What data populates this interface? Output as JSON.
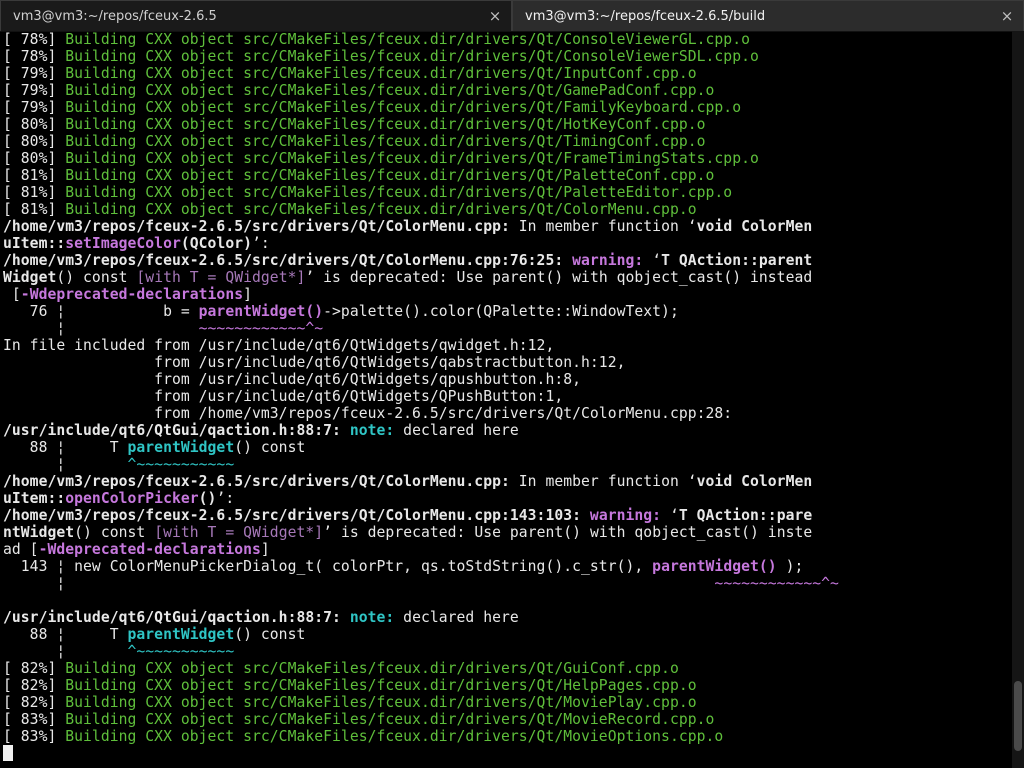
{
  "tabs": [
    {
      "label": "vm3@vm3:~/repos/fceux-2.6.5",
      "close": "×"
    },
    {
      "label": "vm3@vm3:~/repos/fceux-2.6.5/build",
      "close": "×"
    }
  ],
  "terminal": {
    "build1": [
      {
        "pct": "[ 78%] ",
        "msg": "Building CXX object src/CMakeFiles/fceux.dir/drivers/Qt/ConsoleViewerGL.cpp.o"
      },
      {
        "pct": "[ 78%] ",
        "msg": "Building CXX object src/CMakeFiles/fceux.dir/drivers/Qt/ConsoleViewerSDL.cpp.o"
      },
      {
        "pct": "[ 79%] ",
        "msg": "Building CXX object src/CMakeFiles/fceux.dir/drivers/Qt/InputConf.cpp.o"
      },
      {
        "pct": "[ 79%] ",
        "msg": "Building CXX object src/CMakeFiles/fceux.dir/drivers/Qt/GamePadConf.cpp.o"
      },
      {
        "pct": "[ 79%] ",
        "msg": "Building CXX object src/CMakeFiles/fceux.dir/drivers/Qt/FamilyKeyboard.cpp.o"
      },
      {
        "pct": "[ 80%] ",
        "msg": "Building CXX object src/CMakeFiles/fceux.dir/drivers/Qt/HotKeyConf.cpp.o"
      },
      {
        "pct": "[ 80%] ",
        "msg": "Building CXX object src/CMakeFiles/fceux.dir/drivers/Qt/TimingConf.cpp.o"
      },
      {
        "pct": "[ 80%] ",
        "msg": "Building CXX object src/CMakeFiles/fceux.dir/drivers/Qt/FrameTimingStats.cpp.o"
      },
      {
        "pct": "[ 81%] ",
        "msg": "Building CXX object src/CMakeFiles/fceux.dir/drivers/Qt/PaletteConf.cpp.o"
      },
      {
        "pct": "[ 81%] ",
        "msg": "Building CXX object src/CMakeFiles/fceux.dir/drivers/Qt/PaletteEditor.cpp.o"
      },
      {
        "pct": "[ 81%] ",
        "msg": "Building CXX object src/CMakeFiles/fceux.dir/drivers/Qt/ColorMenu.cpp.o"
      }
    ],
    "w1": {
      "l1": "/home/vm3/repos/fceux-2.6.5/src/drivers/Qt/ColorMenu.cpp:",
      "l1b": " In member function ‘",
      "l1c": "void ColorMen",
      "l2a": "uItem::",
      "l2b": "setImageColor",
      "l2c": "(QColor)",
      "l2d": "’:",
      "l3a": "/home/vm3/repos/fceux-2.6.5/src/drivers/Qt/ColorMenu.cpp:76:25: ",
      "l3b": "warning: ",
      "l3c": "‘",
      "l3d": "T QAction::parent",
      "l4a": "Widget",
      "l4b": "() const ",
      "l4c": "[with T = QWidget*]",
      "l4d": "’ is deprecated: Use parent() with qobject_cast() instead",
      "l5a": " [",
      "l5b": "-Wdeprecated-declarations",
      "l5c": "]",
      "l6a": "   76 ¦           b = ",
      "l6b": "parentWidget()",
      "l6c": "->palette().color(QPalette::WindowText);",
      "l7a": "      ¦               ",
      "l7b": "~~~~~~~~~~~~^~",
      "l8": "In file included from /usr/include/qt6/QtWidgets/qwidget.h:12,",
      "l9": "                 from /usr/include/qt6/QtWidgets/qabstractbutton.h:12,",
      "l10": "                 from /usr/include/qt6/QtWidgets/qpushbutton.h:8,",
      "l11": "                 from /usr/include/qt6/QtWidgets/QPushButton:1,",
      "l12": "                 from /home/vm3/repos/fceux-2.6.5/src/drivers/Qt/ColorMenu.cpp:28:",
      "l13a": "/usr/include/qt6/QtGui/qaction.h:88:7: ",
      "l13b": "note: ",
      "l13c": "declared here",
      "l14a": "   88 ¦     T ",
      "l14b": "parentWidget",
      "l14c": "() const",
      "l15a": "      ¦       ",
      "l15b": "^~~~~~~~~~~~"
    },
    "w2": {
      "l1": "/home/vm3/repos/fceux-2.6.5/src/drivers/Qt/ColorMenu.cpp:",
      "l1b": " In member function ‘",
      "l1c": "void ColorMen",
      "l2a": "uItem::",
      "l2b": "openColorPicker",
      "l2c": "()",
      "l2d": "’:",
      "l3a": "/home/vm3/repos/fceux-2.6.5/src/drivers/Qt/ColorMenu.cpp:143:103: ",
      "l3b": "warning: ",
      "l3c": "‘",
      "l3d": "T QAction::pare",
      "l4a": "ntWidget",
      "l4b": "() const ",
      "l4c": "[with T = QWidget*]",
      "l4d": "’ is deprecated: Use parent() with qobject_cast() inste",
      "l5a": "ad [",
      "l5b": "-Wdeprecated-declarations",
      "l5c": "]",
      "l6a": "  143 ¦ new ColorMenuPickerDialog_t( colorPtr, qs.toStdString().c_str(), ",
      "l6b": "parentWidget()",
      "l6c": " );",
      "l7a": "      ¦                                                                         ",
      "l7b": "~~~~~~~~~~~~^~",
      "l13a": "/usr/include/qt6/QtGui/qaction.h:88:7: ",
      "l13b": "note: ",
      "l13c": "declared here",
      "l14a": "   88 ¦     T ",
      "l14b": "parentWidget",
      "l14c": "() const",
      "l15a": "      ¦       ",
      "l15b": "^~~~~~~~~~~~"
    },
    "build2": [
      {
        "pct": "[ 82%] ",
        "msg": "Building CXX object src/CMakeFiles/fceux.dir/drivers/Qt/GuiConf.cpp.o"
      },
      {
        "pct": "[ 82%] ",
        "msg": "Building CXX object src/CMakeFiles/fceux.dir/drivers/Qt/HelpPages.cpp.o"
      },
      {
        "pct": "[ 82%] ",
        "msg": "Building CXX object src/CMakeFiles/fceux.dir/drivers/Qt/MoviePlay.cpp.o"
      },
      {
        "pct": "[ 83%] ",
        "msg": "Building CXX object src/CMakeFiles/fceux.dir/drivers/Qt/MovieRecord.cpp.o"
      },
      {
        "pct": "[ 83%] ",
        "msg": "Building CXX object src/CMakeFiles/fceux.dir/drivers/Qt/MovieOptions.cpp.o"
      }
    ]
  }
}
